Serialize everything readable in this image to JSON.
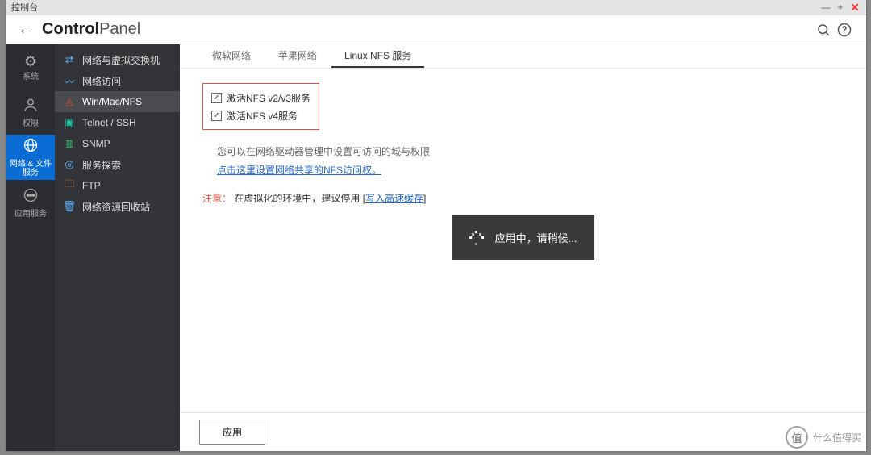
{
  "titlebar": {
    "title": "控制台"
  },
  "header": {
    "title_bold": "Control",
    "title_thin": "Panel"
  },
  "rail": {
    "items": [
      {
        "label": "系统"
      },
      {
        "label": "权限"
      },
      {
        "label": "网络 & 文件服务"
      },
      {
        "label": "应用服务"
      }
    ]
  },
  "sidebar": {
    "items": [
      {
        "label": "网络与虚拟交换机"
      },
      {
        "label": "网络访问"
      },
      {
        "label": "Win/Mac/NFS"
      },
      {
        "label": "Telnet / SSH"
      },
      {
        "label": "SNMP"
      },
      {
        "label": "服务探索"
      },
      {
        "label": "FTP"
      },
      {
        "label": "网络资源回收站"
      }
    ]
  },
  "tabs": {
    "items": [
      {
        "label": "微软网络"
      },
      {
        "label": "苹果网络"
      },
      {
        "label": "Linux NFS 服务"
      }
    ]
  },
  "content": {
    "check1": "激活NFS v2/v3服务",
    "check2": "激活NFS v4服务",
    "info": "您可以在网络驱动器管理中设置可访问的域与权限",
    "link": "点击这里设置网络共享的NFS访问权。",
    "warn_label": "注意：",
    "warn_text": "在虚拟化的环境中，建议停用 [",
    "warn_link": "写入高速缓存",
    "warn_text2": "]"
  },
  "modal": {
    "text": "应用中，请稍候..."
  },
  "footer": {
    "apply": "应用"
  },
  "watermark": {
    "brand": "什么值得买",
    "mark": "值"
  }
}
